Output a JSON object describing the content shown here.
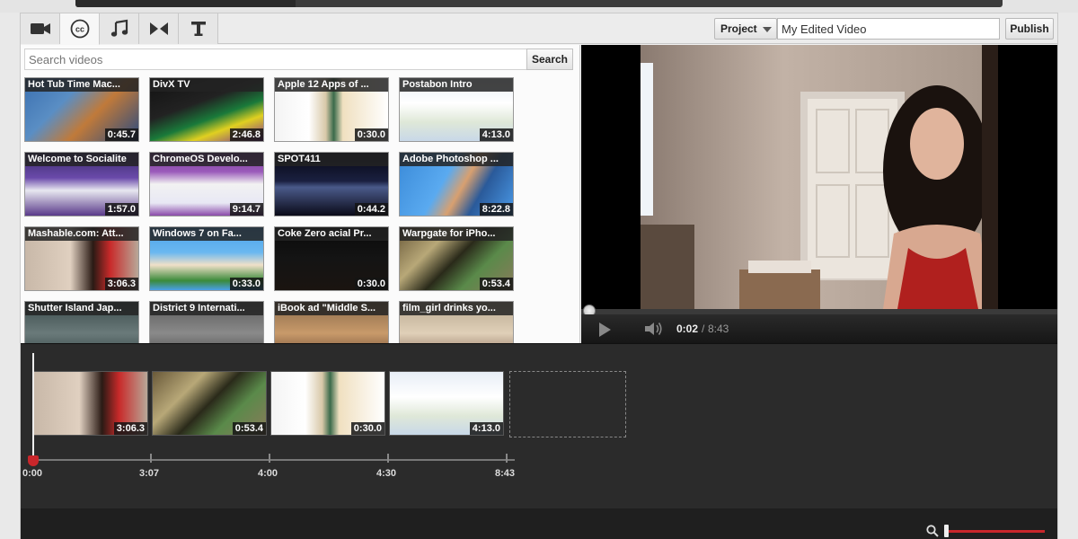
{
  "toolbar": {
    "tabs": [
      {
        "icon": "video-camera-icon"
      },
      {
        "icon": "captions-icon"
      },
      {
        "icon": "music-note-icon"
      },
      {
        "icon": "transitions-icon"
      },
      {
        "icon": "text-icon"
      }
    ],
    "project_label": "Project",
    "project_name": "My Edited Video",
    "publish_label": "Publish"
  },
  "library": {
    "search_placeholder": "Search videos",
    "search_label": "Search",
    "videos": [
      {
        "title": "Hot Tub Time Mac...",
        "duration": "0:45.7"
      },
      {
        "title": "DivX TV",
        "duration": "2:46.8"
      },
      {
        "title": "Apple 12 Apps of ...",
        "duration": "0:30.0"
      },
      {
        "title": "Postabon Intro",
        "duration": "4:13.0"
      },
      {
        "title": "Welcome to Socialite",
        "duration": "1:57.0"
      },
      {
        "title": "ChromeOS Develo...",
        "duration": "9:14.7"
      },
      {
        "title": "SPOT411",
        "duration": "0:44.2"
      },
      {
        "title": "Adobe Photoshop ...",
        "duration": "8:22.8"
      },
      {
        "title": "Mashable.com: Att...",
        "duration": "3:06.3"
      },
      {
        "title": "Windows 7 on Fa...",
        "duration": "0:33.0"
      },
      {
        "title": "Coke Zero acial Pr...",
        "duration": "0:30.0"
      },
      {
        "title": "Warpgate for iPho...",
        "duration": "0:53.4"
      },
      {
        "title": "Shutter Island Jap...",
        "duration": ""
      },
      {
        "title": "District 9 Internati...",
        "duration": ""
      },
      {
        "title": "iBook ad \"Middle S...",
        "duration": ""
      },
      {
        "title": "film_girl drinks yo...",
        "duration": ""
      }
    ]
  },
  "player": {
    "current_time": "0:02",
    "separator": "/",
    "total_time": "8:43",
    "progress_fraction": 0.004
  },
  "timeline": {
    "clips": [
      {
        "duration": "3:06.3"
      },
      {
        "duration": "0:53.4"
      },
      {
        "duration": "0:30.0"
      },
      {
        "duration": "4:13.0"
      }
    ],
    "ruler_labels": [
      "0:00",
      "3:07",
      "4:00",
      "4:30",
      "8:43"
    ]
  },
  "colors": {
    "accent_red": "#c8262b",
    "timeline_bg": "#2b2b2b"
  }
}
